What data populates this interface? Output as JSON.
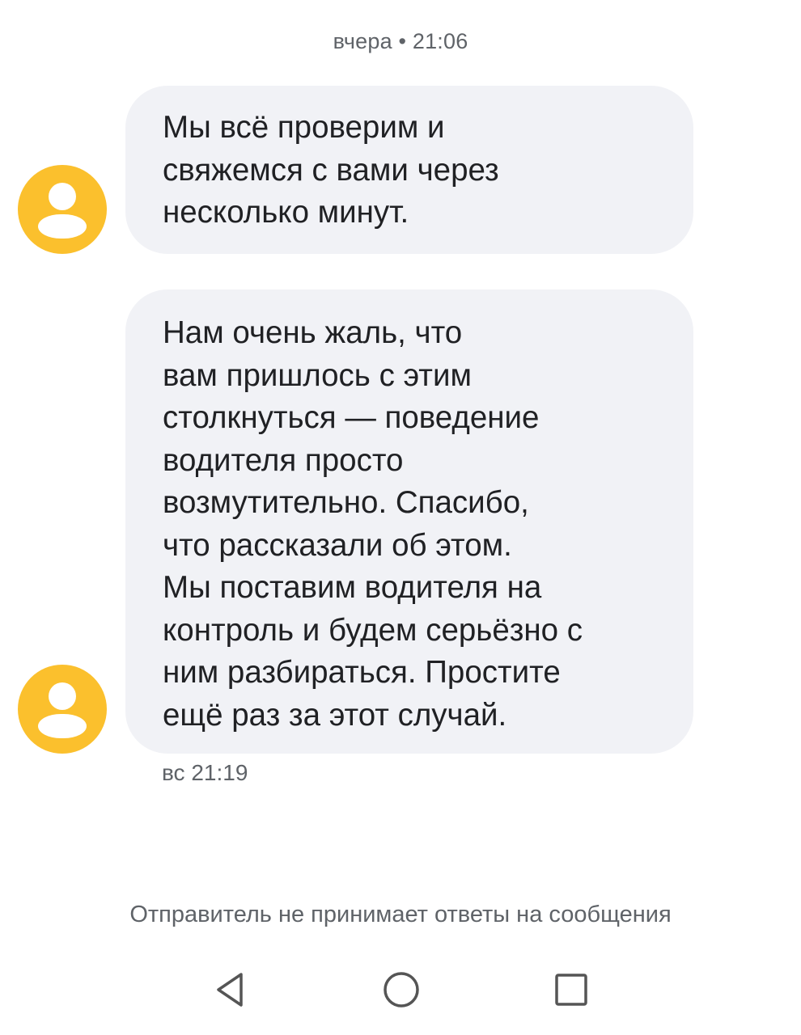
{
  "conversation": {
    "date_header": "вчера • 21:06",
    "messages": [
      {
        "lines": [
          "Мы всё проверим и",
          "свяжемся с вами через",
          "несколько минут."
        ],
        "avatar_icon": "user-avatar-icon"
      },
      {
        "lines": [
          "Нам очень жаль, что",
          "вам пришлось с этим",
          "столкнуться — поведение",
          "водителя просто",
          "возмутительно. Спасибо,",
          "что рассказали об этом.",
          "Мы поставим водителя на",
          "контроль и будем серьёзно с",
          "ним разбираться. Простите",
          "ещё раз за этот случай."
        ],
        "timestamp": "вс 21:19",
        "avatar_icon": "user-avatar-icon"
      }
    ],
    "notice": "Отправитель не принимает ответы на сообщения"
  },
  "navbar": {
    "back_icon": "back-triangle-icon",
    "home_icon": "home-circle-icon",
    "recent_icon": "recent-apps-square-icon"
  },
  "colors": {
    "avatar": "#FBC02D",
    "bubble": "#F1F2F6",
    "secondary_text": "#5f6368",
    "nav_icon": "#555555"
  }
}
